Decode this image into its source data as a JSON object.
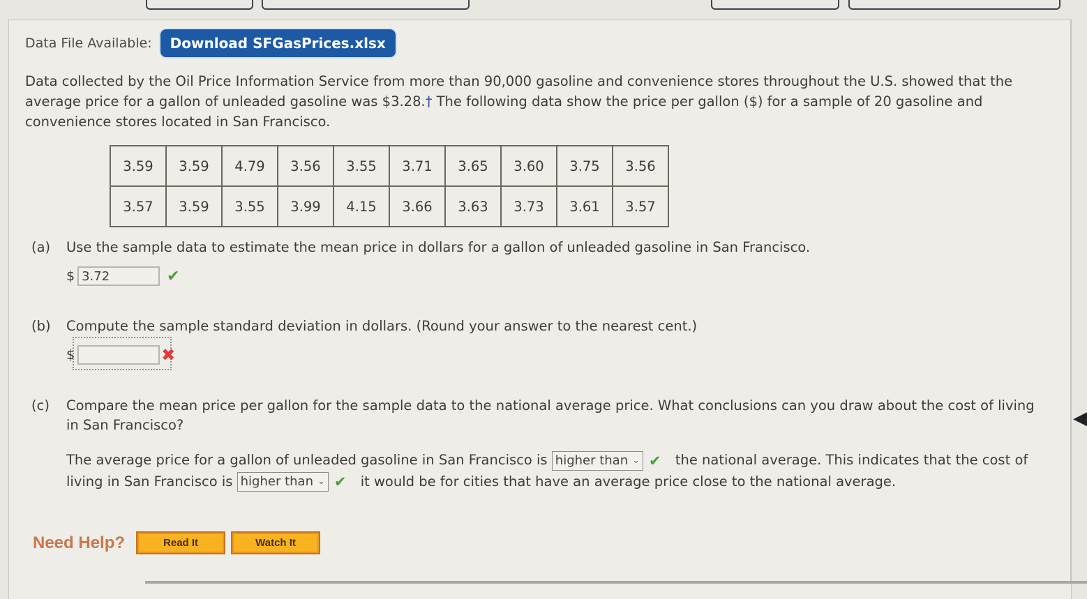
{
  "data_file": {
    "label": "Data File Available:",
    "download_label": "Download SFGasPrices.xlsx"
  },
  "intro": {
    "text_before": "Data collected by the Oil Price Information Service from more than 90,000 gasoline and convenience stores throughout the U.S. showed that the average price for a gallon of unleaded gasoline was $3.28.",
    "dagger": "†",
    "text_after": " The following data show the price per gallon ($) for a sample of 20 gasoline and convenience stores located in San Francisco."
  },
  "prices": {
    "row1": [
      "3.59",
      "3.59",
      "4.79",
      "3.56",
      "3.55",
      "3.71",
      "3.65",
      "3.60",
      "3.75",
      "3.56"
    ],
    "row2": [
      "3.57",
      "3.59",
      "3.55",
      "3.99",
      "4.15",
      "3.66",
      "3.63",
      "3.73",
      "3.61",
      "3.57"
    ]
  },
  "part_a": {
    "label": "(a)",
    "question": "Use the sample data to estimate the mean price in dollars for a gallon of unleaded gasoline in San Francisco.",
    "currency": "$",
    "value": "3.72",
    "status": "correct"
  },
  "part_b": {
    "label": "(b)",
    "question": "Compute the sample standard deviation in dollars. (Round your answer to the nearest cent.)",
    "currency": "$",
    "value": "",
    "status": "incorrect"
  },
  "part_c": {
    "label": "(c)",
    "question": "Compare the mean price per gallon for the sample data to the national average price. What conclusions can you draw about the cost of living in San Francisco?",
    "s1": "The average price for a gallon of unleaded gasoline in San Francisco is",
    "select1": "higher than",
    "s2": "the national average. This indicates that the cost of living in San Francisco is",
    "select2": "higher than",
    "s3": "it would be for cities that have an average price close to the national average."
  },
  "help": {
    "label": "Need Help?",
    "read_it": "Read It",
    "watch_it": "Watch It"
  },
  "icons": {
    "check": "✔",
    "cross": "✖",
    "chevron": "⌄",
    "arrow_left": "◀"
  },
  "colors": {
    "download_button": "#1d5aa5",
    "check_green": "#4a9c3a",
    "cross_red": "#e03a3a",
    "help_orange": "#f9b321",
    "help_label": "#c9774a"
  }
}
